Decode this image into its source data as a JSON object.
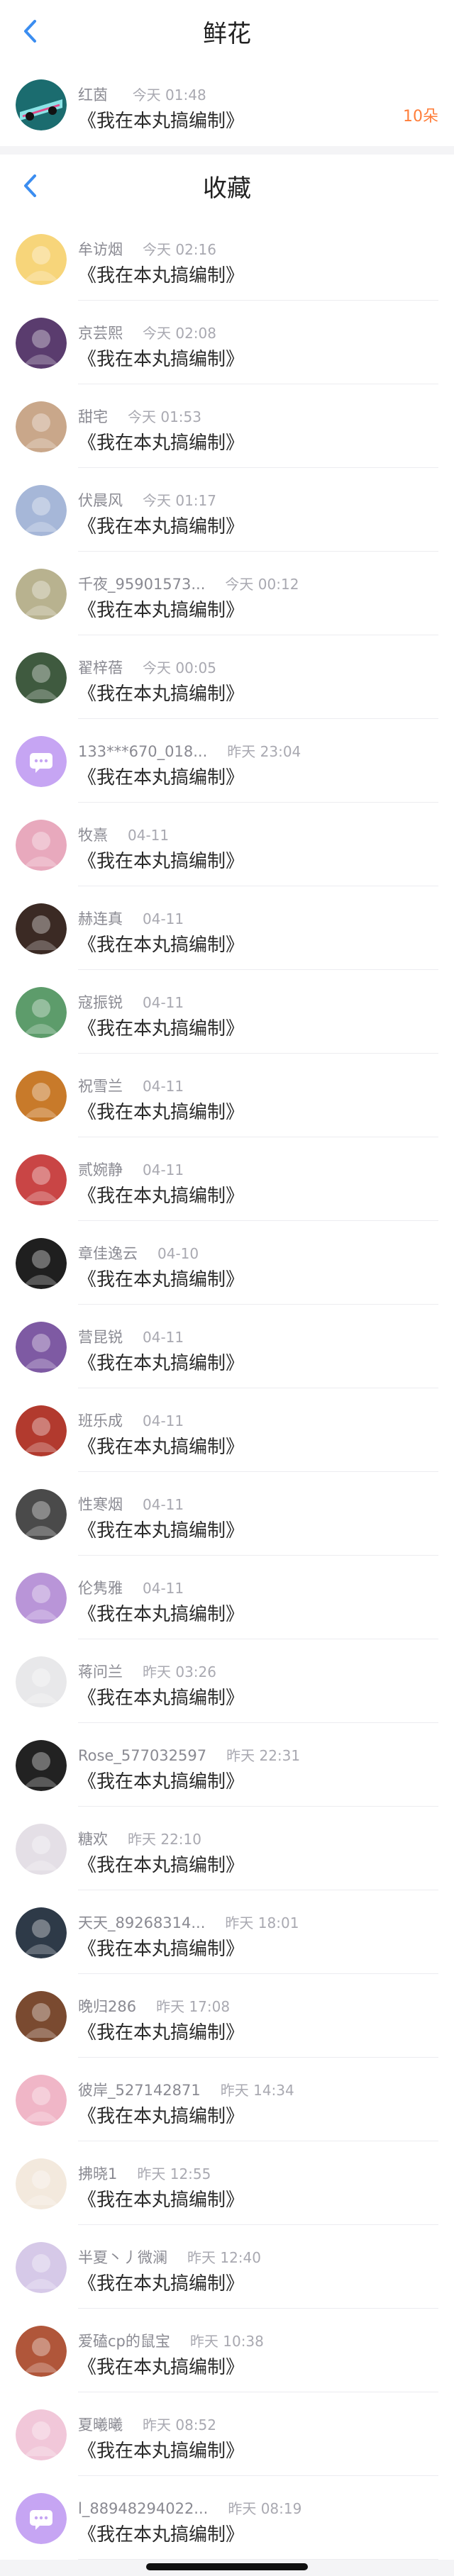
{
  "flowers": {
    "title": "鲜花",
    "item": {
      "name": "红茵",
      "time": "今天 01:48",
      "subtitle": "《我在本丸搞编制》",
      "count": "10朵"
    }
  },
  "favorites": {
    "title": "收藏",
    "items": [
      {
        "name": "牟访烟",
        "time": "今天 02:16",
        "subtitle": "《我在本丸搞编制》",
        "avatar_color": "#f7d57a"
      },
      {
        "name": "京芸熙",
        "time": "今天 02:08",
        "subtitle": "《我在本丸搞编制》",
        "avatar_color": "#5a3c6e"
      },
      {
        "name": "甜宅",
        "time": "今天 01:53",
        "subtitle": "《我在本丸搞编制》",
        "avatar_color": "#c9a78a"
      },
      {
        "name": "伏晨风",
        "time": "今天 01:17",
        "subtitle": "《我在本丸搞编制》",
        "avatar_color": "#a6b7d8"
      },
      {
        "name": "千夜_95901573...",
        "time": "今天 00:12",
        "subtitle": "《我在本丸搞编制》",
        "avatar_color": "#b8b28f"
      },
      {
        "name": "翟梓蓓",
        "time": "今天 00:05",
        "subtitle": "《我在本丸搞编制》",
        "avatar_color": "#3f5a3f"
      },
      {
        "name": "133***670_018...",
        "time": "昨天 23:04",
        "subtitle": "《我在本丸搞编制》",
        "avatar_color": "#c6a5f3"
      },
      {
        "name": "牧熹",
        "time": "04-11",
        "subtitle": "《我在本丸搞编制》",
        "avatar_color": "#e8a9bd"
      },
      {
        "name": "赫连真",
        "time": "04-11",
        "subtitle": "《我在本丸搞编制》",
        "avatar_color": "#3b2a24"
      },
      {
        "name": "寇振锐",
        "time": "04-11",
        "subtitle": "《我在本丸搞编制》",
        "avatar_color": "#5d9c6b"
      },
      {
        "name": "祝雪兰",
        "time": "04-11",
        "subtitle": "《我在本丸搞编制》",
        "avatar_color": "#c87a2a"
      },
      {
        "name": "贰婉静",
        "time": "04-11",
        "subtitle": "《我在本丸搞编制》",
        "avatar_color": "#c94545"
      },
      {
        "name": "章佳逸云",
        "time": "04-10",
        "subtitle": "《我在本丸搞编制》",
        "avatar_color": "#1f1f1f"
      },
      {
        "name": "营昆锐",
        "time": "04-11",
        "subtitle": "《我在本丸搞编制》",
        "avatar_color": "#7e5aa3"
      },
      {
        "name": "班乐成",
        "time": "04-11",
        "subtitle": "《我在本丸搞编制》",
        "avatar_color": "#b23a2e"
      },
      {
        "name": "性寒烟",
        "time": "04-11",
        "subtitle": "《我在本丸搞编制》",
        "avatar_color": "#4a4a4a"
      },
      {
        "name": "伦隽雅",
        "time": "04-11",
        "subtitle": "《我在本丸搞编制》",
        "avatar_color": "#b995d8"
      },
      {
        "name": "蒋问兰",
        "time": "昨天 03:26",
        "subtitle": "《我在本丸搞编制》",
        "avatar_color": "#e8e8ea"
      },
      {
        "name": "Rose_577032597",
        "time": "昨天 22:31",
        "subtitle": "《我在本丸搞编制》",
        "avatar_color": "#222222"
      },
      {
        "name": "糖欢",
        "time": "昨天 22:10",
        "subtitle": "《我在本丸搞编制》",
        "avatar_color": "#e4dfe6"
      },
      {
        "name": "天天_89268314...",
        "time": "昨天 18:01",
        "subtitle": "《我在本丸搞编制》",
        "avatar_color": "#2e3a48"
      },
      {
        "name": "晚归286",
        "time": "昨天 17:08",
        "subtitle": "《我在本丸搞编制》",
        "avatar_color": "#7a4a30"
      },
      {
        "name": "彼岸_527142871",
        "time": "昨天 14:34",
        "subtitle": "《我在本丸搞编制》",
        "avatar_color": "#f0b6c7"
      },
      {
        "name": "拂晓1",
        "time": "昨天 12:55",
        "subtitle": "《我在本丸搞编制》",
        "avatar_color": "#f3e9dd"
      },
      {
        "name": "半夏丶丿微澜",
        "time": "昨天 12:40",
        "subtitle": "《我在本丸搞编制》",
        "avatar_color": "#d6c9e8"
      },
      {
        "name": "爱磕cp的鼠宝",
        "time": "昨天 10:38",
        "subtitle": "《我在本丸搞编制》",
        "avatar_color": "#b0563a"
      },
      {
        "name": "夏曦曦",
        "time": "昨天 08:52",
        "subtitle": "《我在本丸搞编制》",
        "avatar_color": "#f1c7d9"
      },
      {
        "name": "l_88948294022...",
        "time": "昨天 08:19",
        "subtitle": "《我在本丸搞编制》",
        "avatar_color": "#c6a5f3"
      }
    ]
  }
}
